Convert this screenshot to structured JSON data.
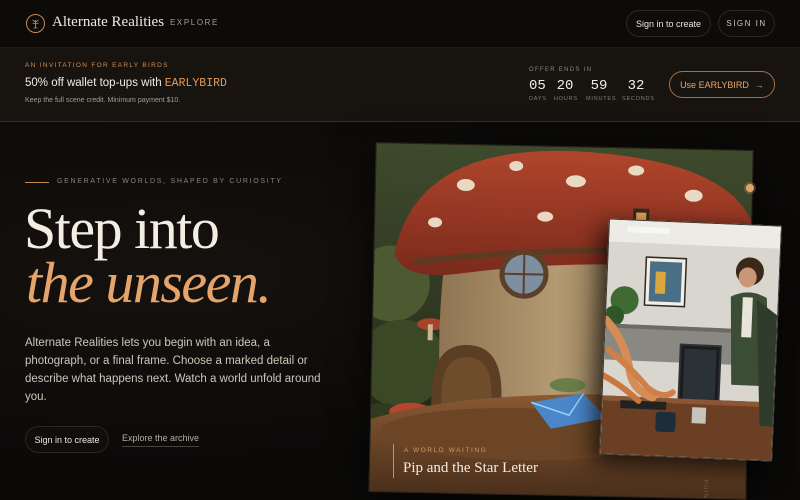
{
  "nav": {
    "brand": "Alternate Realities",
    "explore": "EXPLORE",
    "signin_create": "Sign in to create",
    "signin": "SIGN IN"
  },
  "promo": {
    "eyebrow": "AN INVITATION FOR EARLY BIRDS",
    "headline_prefix": "50% off wallet top-ups with ",
    "code": "EARLYBIRD",
    "sub": "Keep the full scene credit. Minimum payment $10.",
    "offer_label": "OFFER ENDS IN",
    "countdown": [
      {
        "value": "05",
        "label": "DAYS"
      },
      {
        "value": "20",
        "label": "HOURS"
      },
      {
        "value": "59",
        "label": "MINUTES"
      },
      {
        "value": "32",
        "label": "SECONDS"
      }
    ],
    "cta": "Use EARLYBIRD",
    "cta_arrow": "→"
  },
  "hero": {
    "eyebrow": "GENERATIVE WORLDS, SHAPED BY CURIOSITY",
    "title_line1": "Step into",
    "title_line2": "the unseen.",
    "lede": "Alternate Realities lets you begin with an idea, a photograph, or a final frame. Choose a marked detail or describe what happens next. Watch a world unfold around you.",
    "signin": "Sign in to create",
    "archive": "Explore the archive"
  },
  "art": {
    "caption_eyebrow": "A WORLD WAITING",
    "caption_title": "Pip and the Star Letter",
    "side_text": "POIN"
  },
  "colors": {
    "accent": "#e5a56a",
    "background": "#0b0a09",
    "banner": "#17130f"
  },
  "icons": {
    "logo": "tree-of-life-icon",
    "cta": "arrow-right-icon"
  }
}
